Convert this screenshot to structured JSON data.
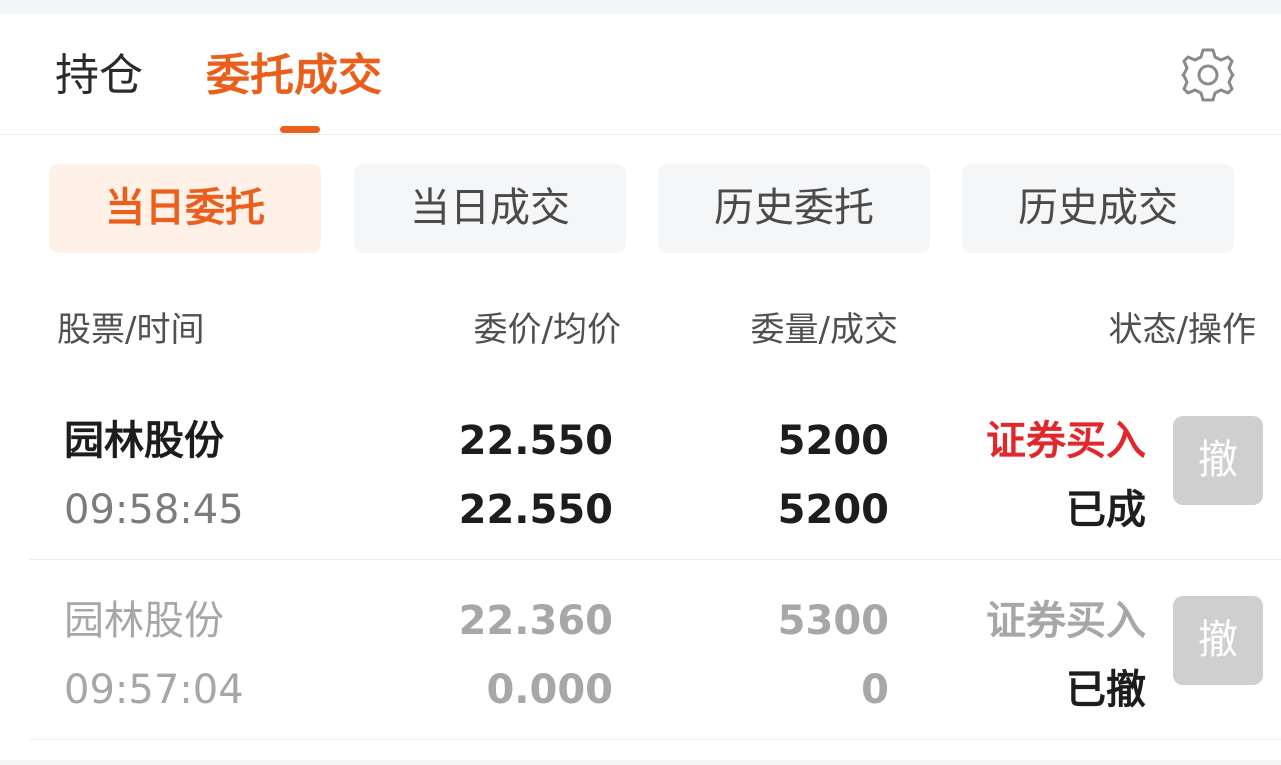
{
  "tabs": {
    "items": [
      {
        "label": "持仓"
      },
      {
        "label": "委托成交"
      }
    ],
    "active_index": 1,
    "settings_icon": "gear-icon"
  },
  "subtabs": {
    "items": [
      {
        "label": "当日委托"
      },
      {
        "label": "当日成交"
      },
      {
        "label": "历史委托"
      },
      {
        "label": "历史成交"
      }
    ],
    "active_index": 0
  },
  "table": {
    "headers": [
      "股票/时间",
      "委价/均价",
      "委量/成交",
      "状态/操作"
    ],
    "rows": [
      {
        "name": "园林股份",
        "time": "09:58:45",
        "order_price": "22.550",
        "avg_price": "22.550",
        "order_qty": "5200",
        "filled_qty": "5200",
        "type": "证券买入",
        "status": "已成",
        "action": "撤",
        "type_color": "#e3262b"
      },
      {
        "name": "园林股份",
        "time": "09:57:04",
        "order_price": "22.360",
        "avg_price": "0.000",
        "order_qty": "5300",
        "filled_qty": "0",
        "type": "证券买入",
        "status": "已撤",
        "action": "撤",
        "type_color": "#a7a7a7"
      }
    ]
  },
  "colors": {
    "accent": "#ea5f1c",
    "buy_red": "#e3262b",
    "disabled_gray": "#a7a7a7",
    "cancel_button_bg": "#cfcfcf"
  }
}
